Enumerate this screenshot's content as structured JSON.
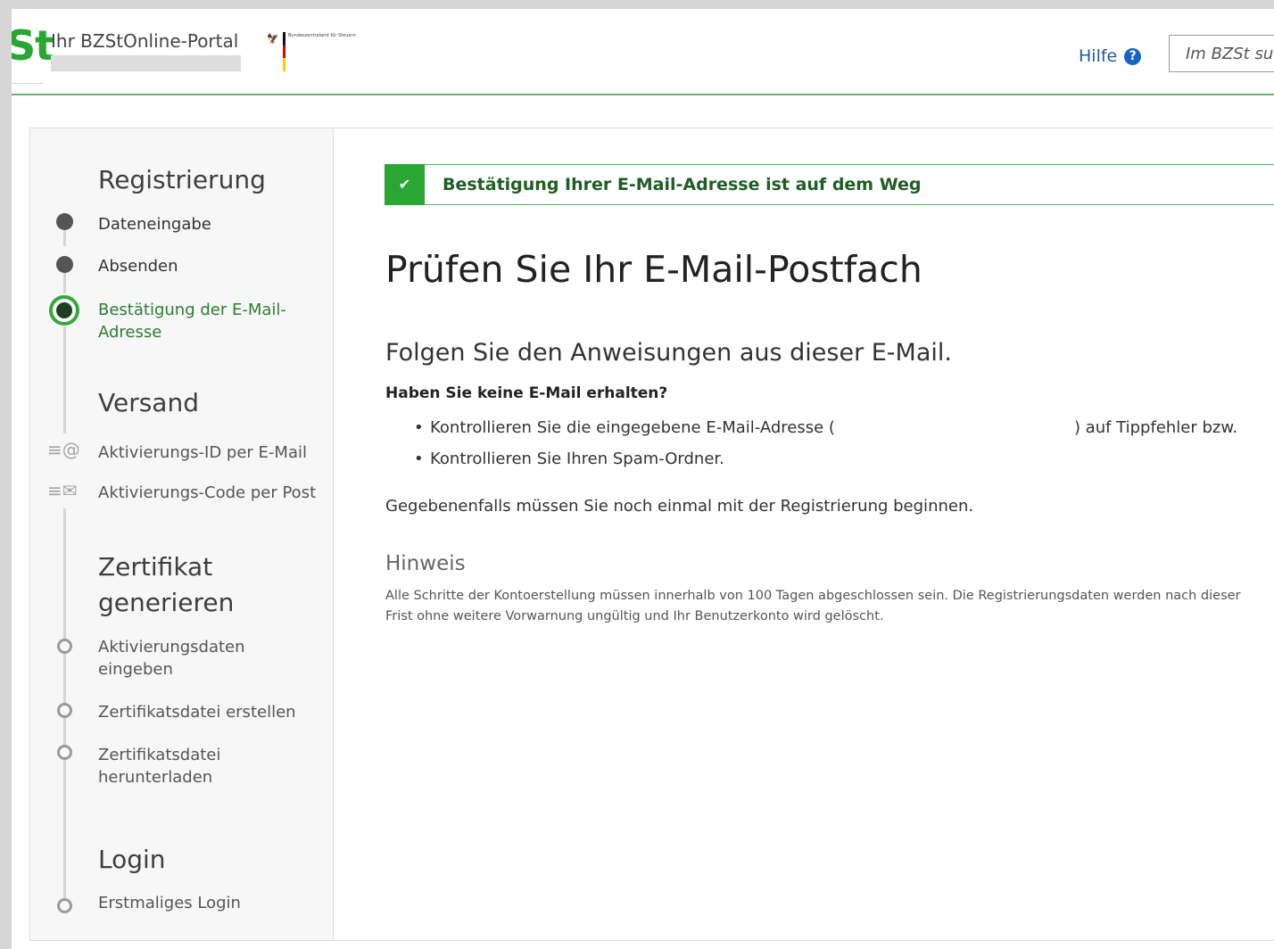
{
  "header": {
    "logo_mark": "St",
    "portal_title": "Ihr BZStOnline-Portal",
    "gov_logo_text": "Bundeszentralamt für Steuern",
    "help_label": "Hilfe",
    "help_icon": "question-circle-icon",
    "search_placeholder": "Im BZSt suchen",
    "accent_color": "#2aa632"
  },
  "sidebar": {
    "sections": [
      {
        "heading": "Registrierung",
        "steps": [
          {
            "label": "Dateneingabe",
            "state": "done"
          },
          {
            "label": "Absenden",
            "state": "done"
          },
          {
            "label": "Bestätigung der E-Mail-Adresse",
            "state": "active"
          }
        ]
      },
      {
        "heading": "Versand",
        "steps": [
          {
            "label": "Aktivierungs-ID per E-Mail",
            "state": "future",
            "icon": "email-at-icon"
          },
          {
            "label": "Aktivierungs-Code per Post",
            "state": "future",
            "icon": "envelope-icon"
          }
        ]
      },
      {
        "heading": "Zertifikat generieren",
        "steps": [
          {
            "label": "Aktivierungsdaten eingeben",
            "state": "future"
          },
          {
            "label": "Zertifikatsdatei erstellen",
            "state": "future"
          },
          {
            "label": "Zertifikatsdatei herunterladen",
            "state": "future"
          }
        ]
      },
      {
        "heading": "Login",
        "steps": [
          {
            "label": "Erstmaliges Login",
            "state": "future"
          }
        ]
      }
    ]
  },
  "content": {
    "alert_text": "Bestätigung Ihrer E-Mail-Adresse ist auf dem Weg",
    "alert_icon": "checkmark-icon",
    "title": "Prüfen Sie Ihr E-Mail-Postfach",
    "subtitle": "Folgen Sie den Anweisungen aus dieser E-Mail.",
    "question": "Haben Sie keine E-Mail erhalten?",
    "bullets": {
      "first_prefix": "Kontrollieren Sie die eingegebene E-Mail-Adresse (",
      "first_suffix": ") auf Tippfehler bzw.",
      "second": "Kontrollieren Sie Ihren Spam-Ordner."
    },
    "restart_text": "Gegebenenfalls müssen Sie noch einmal mit der Registrierung beginnen.",
    "hint_heading": "Hinweis",
    "hint_text": "Alle Schritte der Kontoerstellung müssen innerhalb von 100 Tagen abgeschlossen sein. Die Registrierungsdaten werden nach dieser Frist ohne weitere Vorwarnung ungültig und Ihr Benutzerkonto wird gelöscht."
  }
}
